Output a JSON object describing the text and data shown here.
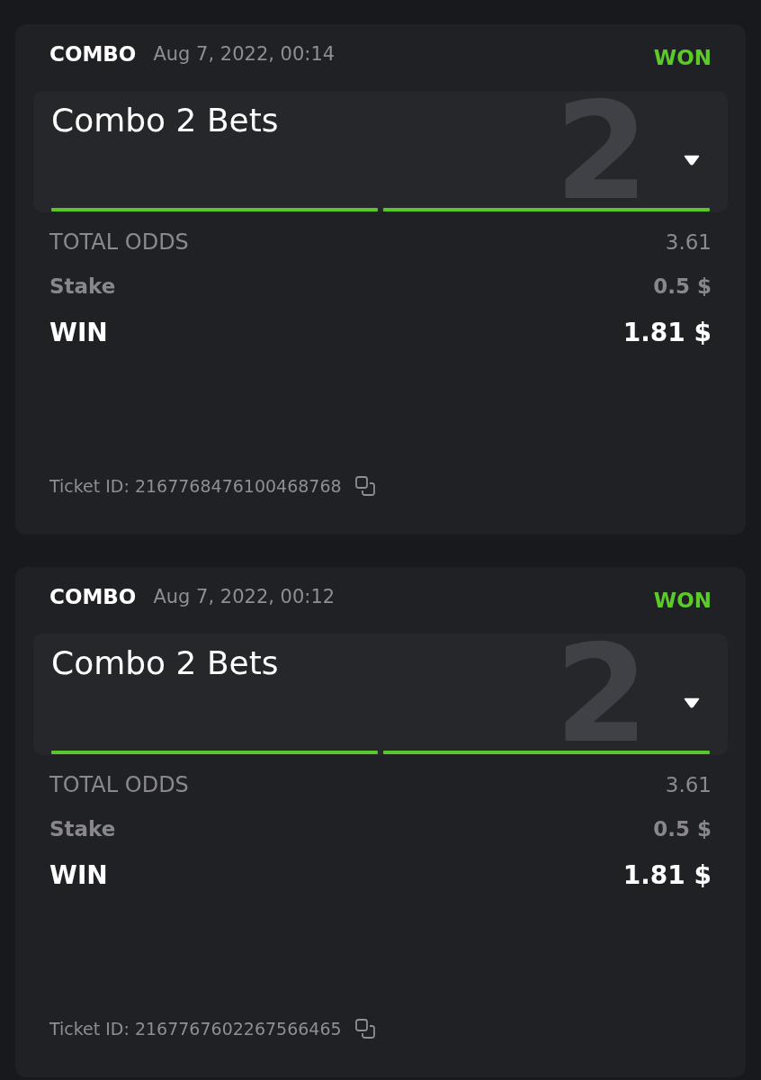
{
  "tickets": [
    {
      "type": "COMBO",
      "date": "Aug 7, 2022, 00:14",
      "status": {
        "label": "WON",
        "kind": "won"
      },
      "title": "Combo 2 Bets",
      "leg_count": "2",
      "expanded": false,
      "legs": [
        {
          "won": true
        },
        {
          "won": true
        }
      ],
      "total_odds": {
        "label": "TOTAL ODDS",
        "value": "3.61"
      },
      "stake": {
        "label": "Stake",
        "value": "0.5 $"
      },
      "win": {
        "label": "WIN",
        "value": "1.81 $"
      },
      "ticket_id": "Ticket ID: 2167768476100468768"
    },
    {
      "type": "COMBO",
      "date": "Aug 7, 2022, 00:12",
      "status": {
        "label": "WON",
        "kind": "won"
      },
      "title": "Combo 2 Bets",
      "leg_count": "2",
      "expanded": false,
      "legs": [
        {
          "won": true
        },
        {
          "won": true
        }
      ],
      "total_odds": {
        "label": "TOTAL ODDS",
        "value": "3.61"
      },
      "stake": {
        "label": "Stake",
        "value": "0.5 $"
      },
      "win": {
        "label": "WIN",
        "value": "1.81 $"
      },
      "ticket_id": "Ticket ID: 2167767602267566465"
    }
  ]
}
